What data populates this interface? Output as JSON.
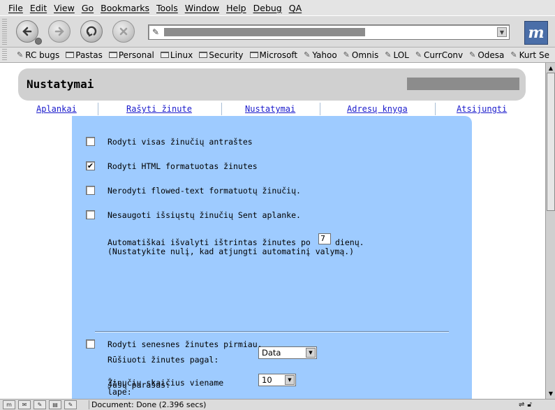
{
  "menubar": {
    "items": [
      "File",
      "Edit",
      "View",
      "Go",
      "Bookmarks",
      "Tools",
      "Window",
      "Help",
      "Debug",
      "QA"
    ]
  },
  "toolbar": {
    "back_icon": "back-arrow-icon",
    "forward_icon": "forward-arrow-icon",
    "reload_icon": "reload-icon",
    "stop_icon": "stop-icon",
    "throbber_letter": "m"
  },
  "bookmarks": [
    {
      "label": "RC bugs",
      "type": "link"
    },
    {
      "label": "Pastas",
      "type": "folder"
    },
    {
      "label": "Personal",
      "type": "folder"
    },
    {
      "label": "Linux",
      "type": "folder"
    },
    {
      "label": "Security",
      "type": "folder"
    },
    {
      "label": "Microsoft",
      "type": "folder"
    },
    {
      "label": "Yahoo",
      "type": "link"
    },
    {
      "label": "Omnis",
      "type": "link"
    },
    {
      "label": "LOL",
      "type": "link"
    },
    {
      "label": "CurrConv",
      "type": "link"
    },
    {
      "label": "Odesa",
      "type": "link"
    },
    {
      "label": "Kurt Se",
      "type": "link"
    }
  ],
  "page": {
    "title": "Nustatymai",
    "nav": [
      "Aplankai",
      "Rašyti žinute",
      "Nustatymai",
      "Adresų knyga",
      "Atsijungti"
    ],
    "options": {
      "show_headers": "Rodyti visas žinučių antraštes",
      "show_html": "Rodyti HTML formatuotas žinutes",
      "no_flowed": "Nerodyti flowed-text formatuotų žinučių.",
      "no_save_sent": "Nesaugoti išsiųstų žinučių Sent aplanke.",
      "purge_prefix": "Automatiškai išvalyti ištrintas žinutes po",
      "purge_days": "7",
      "purge_suffix": "dienų.",
      "purge_note": "(Nustatykite nulį, kad atjungti automatinį valymą.)",
      "sort_label": "Rūšiuoti žinutes pagal:",
      "sort_value": "Data",
      "per_page_label_1": "Žinučių skaičius viename",
      "per_page_label_2": "lape:",
      "per_page_value": "10",
      "oldest_first": "Rodyti senesnes žinutes pirmiau.",
      "signature_label": "Jūsų parašas:"
    },
    "checked": {
      "show_headers": false,
      "show_html": true,
      "no_flowed": false,
      "no_save_sent": false,
      "oldest_first": false
    },
    "check_mark": "✔"
  },
  "status": {
    "text": "Document: Done (2.396 secs)"
  },
  "colors": {
    "panel": "#9ecbff",
    "link": "#1a1acc",
    "header": "#d0d0d0"
  }
}
